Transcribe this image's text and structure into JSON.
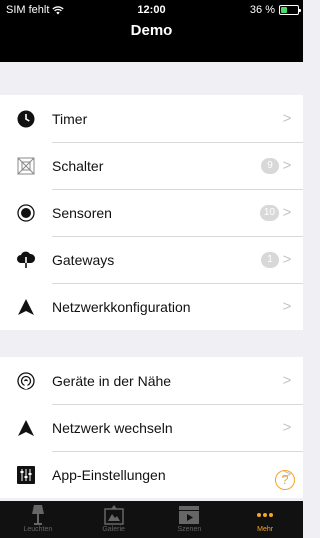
{
  "status_bar": {
    "carrier": "SIM fehlt",
    "time": "12:00",
    "battery_percent": "36 %",
    "battery_level": 0.36
  },
  "nav": {
    "title": "Demo"
  },
  "menu_section_1": [
    {
      "label": "Timer",
      "icon": "clock-icon",
      "badge": ""
    },
    {
      "label": "Schalter",
      "icon": "switch-icon",
      "badge": "9"
    },
    {
      "label": "Sensoren",
      "icon": "sensor-icon",
      "badge": "10"
    },
    {
      "label": "Gateways",
      "icon": "gateway-icon",
      "badge": "1"
    },
    {
      "label": "Netzwerkkonfiguration",
      "icon": "network-icon",
      "badge": ""
    }
  ],
  "menu_section_2": [
    {
      "label": "Geräte in der Nähe",
      "icon": "nearby-icon",
      "badge": ""
    },
    {
      "label": "Netzwerk wechseln",
      "icon": "network-icon",
      "badge": ""
    },
    {
      "label": "App-Einstellungen",
      "icon": "settings-icon",
      "badge": ""
    }
  ],
  "chevron": ">",
  "help": {
    "label": "?"
  },
  "tabs": [
    {
      "label": "Leuchten",
      "icon": "lamp-icon",
      "active": false
    },
    {
      "label": "Galerie",
      "icon": "gallery-icon",
      "active": false
    },
    {
      "label": "Szenen",
      "icon": "scenes-icon",
      "active": false
    },
    {
      "label": "Mehr",
      "icon": "more-icon",
      "active": true
    }
  ],
  "colors": {
    "accent": "#f5a623",
    "bar_bg": "#000000",
    "background": "#efeff4"
  }
}
